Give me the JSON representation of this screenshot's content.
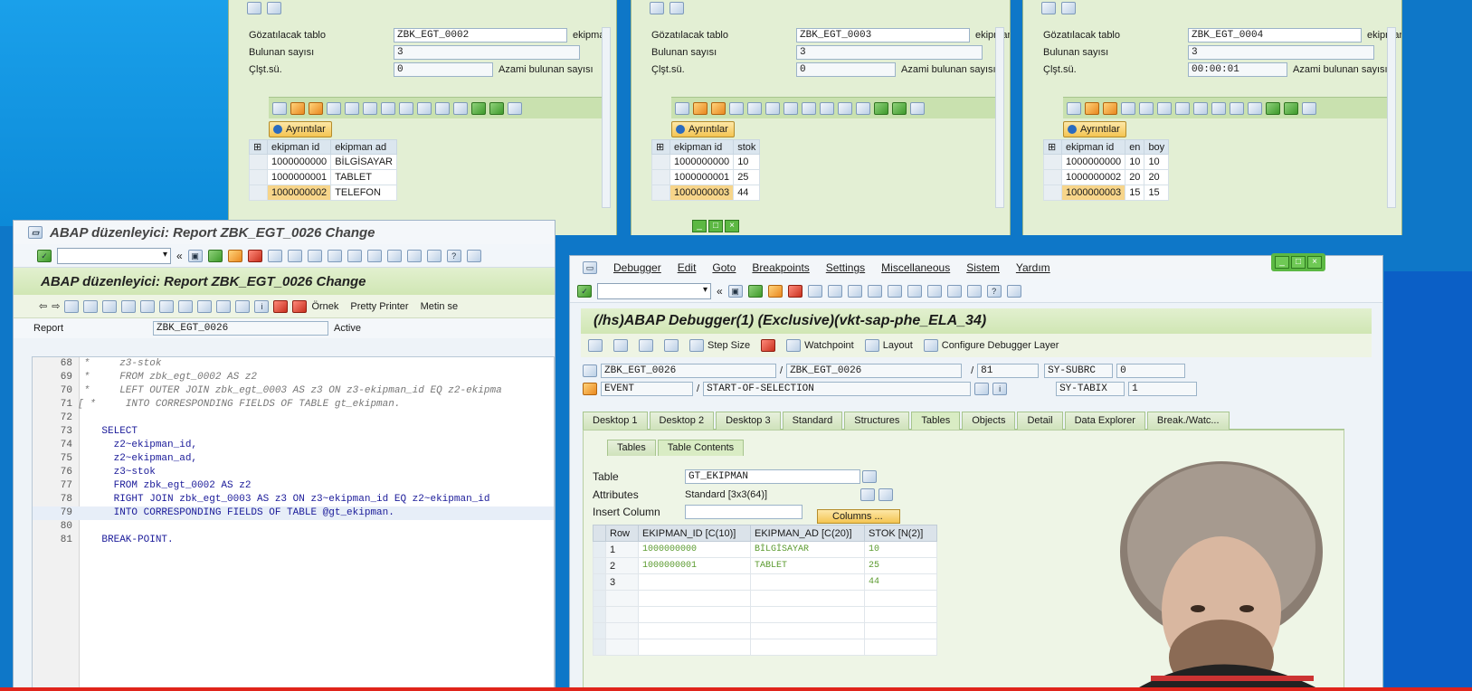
{
  "browse_panels": [
    {
      "table_label": "Gözatılacak tablo",
      "table_value": "ZBK_EGT_0002",
      "tail": "ekipman",
      "count_label": "Bulunan sayısı",
      "count_value": "3",
      "time_label": "Çlşt.sü.",
      "time_value": "0",
      "max_label": "Azami bulunan sayısı",
      "details_button": "Ayrıntılar",
      "headers": [
        "ekipman id",
        "ekipman ad"
      ],
      "rows": [
        [
          "1000000000",
          "BİLGİSAYAR"
        ],
        [
          "1000000001",
          "TABLET"
        ],
        [
          "1000000002",
          "TELEFON"
        ]
      ],
      "selected_row": 2
    },
    {
      "table_label": "Gözatılacak tablo",
      "table_value": "ZBK_EGT_0003",
      "tail": "ekipman",
      "count_label": "Bulunan sayısı",
      "count_value": "3",
      "time_label": "Çlşt.sü.",
      "time_value": "0",
      "max_label": "Azami bulunan sayısı",
      "details_button": "Ayrıntılar",
      "headers": [
        "ekipman id",
        "stok"
      ],
      "rows": [
        [
          "1000000000",
          "10"
        ],
        [
          "1000000001",
          "25"
        ],
        [
          "1000000003",
          "44"
        ]
      ],
      "selected_row": 2
    },
    {
      "table_label": "Gözatılacak tablo",
      "table_value": "ZBK_EGT_0004",
      "tail": "ekipman",
      "count_label": "Bulunan sayısı",
      "count_value": "3",
      "time_label": "Çlşt.sü.",
      "time_value": "00:00:01",
      "max_label": "Azami bulunan sayısı",
      "details_button": "Ayrıntılar",
      "headers": [
        "ekipman id",
        "en",
        "boy"
      ],
      "rows": [
        [
          "1000000000",
          "10",
          "10"
        ],
        [
          "1000000002",
          "20",
          "20"
        ],
        [
          "1000000003",
          "15",
          "15"
        ]
      ],
      "selected_row": 2
    }
  ],
  "editor": {
    "window_title": "ABAP düzenleyici: Report ZBK_EGT_0026 Change",
    "header_title": "ABAP düzenleyici: Report ZBK_EGT_0026 Change",
    "app_bar_items": [
      "Örnek",
      "Pretty Printer",
      "Metin se"
    ],
    "report_label": "Report",
    "report_value": "ZBK_EGT_0026",
    "report_status": "Active",
    "lines": [
      {
        "n": "68",
        "t": " *     z3-stok",
        "type": "cm"
      },
      {
        "n": "69",
        "t": " *     FROM zbk_egt_0002 AS z2",
        "type": "cm"
      },
      {
        "n": "70",
        "t": " *     LEFT OUTER JOIN zbk_egt_0003 AS z3 ON z3-ekipman_id EQ z2-ekipma",
        "type": "cm"
      },
      {
        "n": "71",
        "t": "[ *     INTO CORRESPONDING FIELDS OF TABLE gt_ekipman.",
        "type": "cm"
      },
      {
        "n": "72",
        "t": "",
        "type": "code"
      },
      {
        "n": "73",
        "t": "    SELECT",
        "type": "code"
      },
      {
        "n": "74",
        "t": "      z2~ekipman_id,",
        "type": "code"
      },
      {
        "n": "75",
        "t": "      z2~ekipman_ad,",
        "type": "code"
      },
      {
        "n": "76",
        "t": "      z3~stok",
        "type": "code"
      },
      {
        "n": "77",
        "t": "      FROM zbk_egt_0002 AS z2",
        "type": "code"
      },
      {
        "n": "78",
        "t": "      RIGHT JOIN zbk_egt_0003 AS z3 ON z3~ekipman_id EQ z2~ekipman_id",
        "type": "code"
      },
      {
        "n": "79",
        "t": "      INTO CORRESPONDING FIELDS OF TABLE @gt_ekipman.",
        "type": "hl"
      },
      {
        "n": "80",
        "t": "",
        "type": "code"
      },
      {
        "n": "81",
        "t": "    BREAK-POINT.",
        "type": "code"
      }
    ]
  },
  "debugger": {
    "menu": [
      "Debugger",
      "Edit",
      "Goto",
      "Breakpoints",
      "Settings",
      "Miscellaneous",
      "Sistem",
      "Yardım"
    ],
    "title": "(/hs)ABAP Debugger(1)  (Exclusive)(vkt-sap-phe_ELA_34)",
    "app_bar": [
      "Step Size",
      "Watchpoint",
      "Layout",
      "Configure Debugger Layer"
    ],
    "program": "ZBK_EGT_0026",
    "include": "ZBK_EGT_0026",
    "line": "81",
    "sy_subrc_label": "SY-SUBRC",
    "sy_subrc": "0",
    "event_type": "EVENT",
    "event": "START-OF-SELECTION",
    "sy_tabix_label": "SY-TABIX",
    "sy_tabix": "1",
    "tabs": [
      "Desktop 1",
      "Desktop 2",
      "Desktop 3",
      "Standard",
      "Structures",
      "Tables",
      "Objects",
      "Detail",
      "Data Explorer",
      "Break./Watc..."
    ],
    "active_tab": "Tables",
    "subtabs": [
      "Tables",
      "Table Contents"
    ],
    "table_label": "Table",
    "table_value": "GT_EKIPMAN",
    "attributes_label": "Attributes",
    "attributes_value": "Standard [3x3(64)]",
    "insert_column_label": "Insert Column",
    "columns_button": "Columns ...",
    "grid_headers": [
      "Row",
      "EKIPMAN_ID [C(10)]",
      "EKIPMAN_AD [C(20)]",
      "STOK [N(2)]"
    ],
    "grid_rows": [
      [
        "1",
        "1000000000",
        "BİLGİSAYAR",
        "10"
      ],
      [
        "2",
        "1000000001",
        "TABLET",
        "25"
      ],
      [
        "3",
        "",
        "",
        "44"
      ]
    ]
  },
  "colors": {
    "sap_green": "#d0e6b4",
    "selected": "#f7d58a",
    "desktop_blue": "#0e77c8"
  }
}
